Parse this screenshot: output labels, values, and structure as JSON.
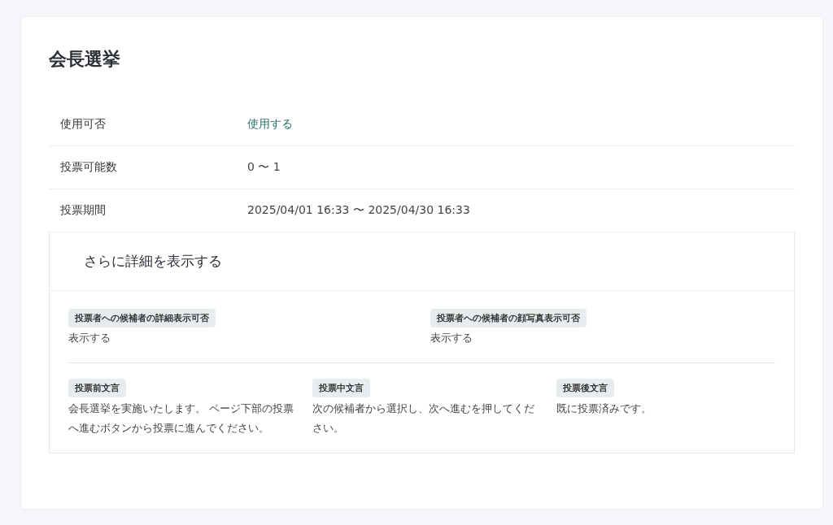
{
  "title": "会長選挙",
  "rows": [
    {
      "label": "使用可否",
      "value": "使用する",
      "kind": "status"
    },
    {
      "label": "投票可能数",
      "value": "0 〜 1",
      "kind": "text"
    },
    {
      "label": "投票期間",
      "value": "2025/04/01 16:33 〜 2025/04/30 16:33",
      "kind": "text"
    }
  ],
  "details": {
    "heading": "さらに詳細を表示する",
    "settings": [
      {
        "label": "投票者への候補者の詳細表示可否",
        "value": "表示する"
      },
      {
        "label": "投票者への候補者の顔写真表示可否",
        "value": "表示する"
      }
    ],
    "messages": [
      {
        "label": "投票前文言",
        "value": "会長選挙を実施いたします。 ページ下部の投票へ進むボタンから投票に進んでください。"
      },
      {
        "label": "投票中文言",
        "value": "次の候補者から選択し、次へ進むを押してください。"
      },
      {
        "label": "投票後文言",
        "value": "既に投票済みです。"
      }
    ]
  }
}
